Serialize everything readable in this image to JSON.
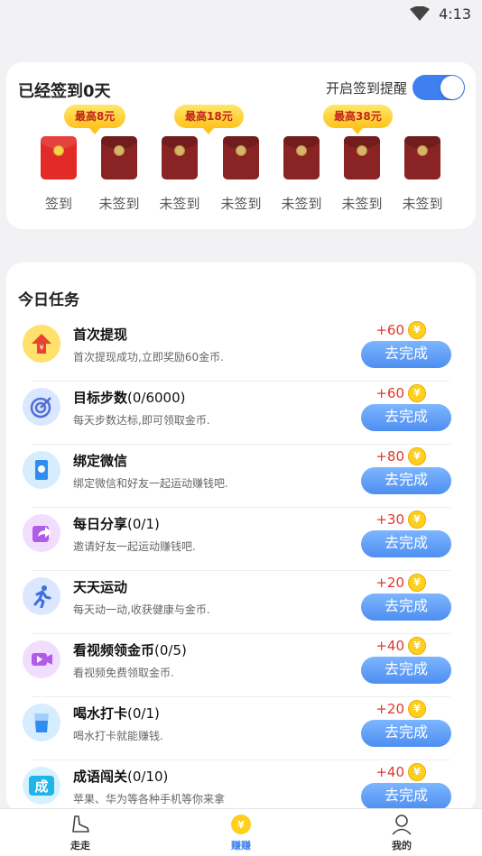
{
  "status_bar": {
    "time": "4:13"
  },
  "signin": {
    "title": "已经签到0天",
    "remind_label": "开启签到提醒",
    "remind_enabled": true,
    "badges": [
      "最高8元",
      "最高18元",
      "最高38元"
    ],
    "days": [
      {
        "label": "签到",
        "signed": true
      },
      {
        "label": "未签到",
        "signed": false
      },
      {
        "label": "未签到",
        "signed": false
      },
      {
        "label": "未签到",
        "signed": false
      },
      {
        "label": "未签到",
        "signed": false
      },
      {
        "label": "未签到",
        "signed": false
      },
      {
        "label": "未签到",
        "signed": false
      }
    ]
  },
  "tasks": {
    "title": "今日任务",
    "items": [
      {
        "name": "首次提现",
        "count": "",
        "desc": "首次提现成功,立即奖励60金币.",
        "reward": "+60",
        "button": "去完成",
        "icon": "withdraw-icon",
        "icon_bg": "#ffe16b"
      },
      {
        "name": "目标步数",
        "count": "(0/6000)",
        "desc": "每天步数达标,即可领取金币.",
        "reward": "+60",
        "button": "去完成",
        "icon": "target-icon",
        "icon_bg": "#dbe6ff"
      },
      {
        "name": "绑定微信",
        "count": "",
        "desc": "绑定微信和好友一起运动赚钱吧.",
        "reward": "+80",
        "button": "去完成",
        "icon": "wechat-icon",
        "icon_bg": "#d6ecff"
      },
      {
        "name": "每日分享",
        "count": "(0/1)",
        "desc": "邀请好友一起运动赚钱吧.",
        "reward": "+30",
        "button": "去完成",
        "icon": "share-icon",
        "icon_bg": "#f1deff"
      },
      {
        "name": "天天运动",
        "count": "",
        "desc": "每天动一动,收获健康与金币.",
        "reward": "+20",
        "button": "去完成",
        "icon": "run-icon",
        "icon_bg": "#dbe6ff"
      },
      {
        "name": "看视频领金币",
        "count": "(0/5)",
        "desc": "看视频免费领取金币.",
        "reward": "+40",
        "button": "去完成",
        "icon": "video-icon",
        "icon_bg": "#f1deff"
      },
      {
        "name": "喝水打卡",
        "count": "(0/1)",
        "desc": "喝水打卡就能赚钱.",
        "reward": "+20",
        "button": "去完成",
        "icon": "water-icon",
        "icon_bg": "#d6ecff"
      },
      {
        "name": "成语闯关",
        "count": "(0/10)",
        "desc": "苹果、华为等各种手机等你来拿",
        "reward": "+40",
        "button": "去完成",
        "icon": "idiom-icon",
        "icon_bg": "#d6f2ff"
      }
    ]
  },
  "bottom_nav": [
    {
      "label": "走走",
      "icon": "shoe-icon",
      "active": false
    },
    {
      "label": "赚赚",
      "icon": "coin-icon",
      "active": true
    },
    {
      "label": "我的",
      "icon": "profile-icon",
      "active": false
    }
  ],
  "colors": {
    "accent": "#3f7ff0",
    "reward": "#e0382c",
    "coin": "#ffcf1f"
  }
}
